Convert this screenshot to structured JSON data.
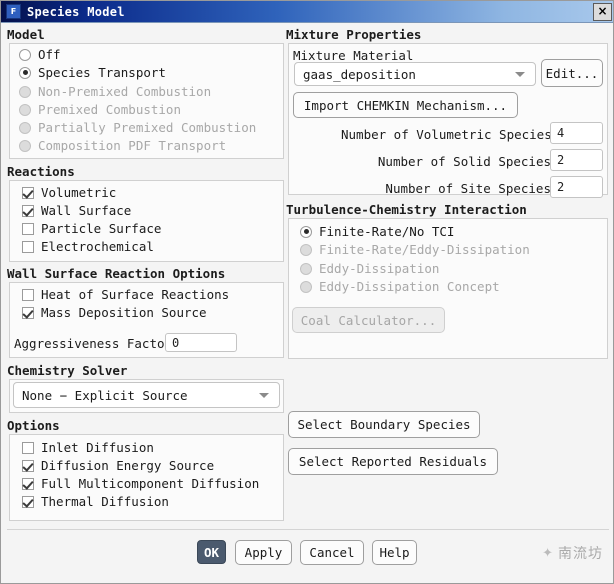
{
  "window": {
    "title": "Species Model",
    "icon": "fluent-app-icon",
    "close_label": "×"
  },
  "left": {
    "model": {
      "title": "Model",
      "options": [
        {
          "label": "Off",
          "selected": false,
          "disabled": false
        },
        {
          "label": "Species Transport",
          "selected": true,
          "disabled": false
        },
        {
          "label": "Non-Premixed Combustion",
          "selected": false,
          "disabled": true
        },
        {
          "label": "Premixed Combustion",
          "selected": false,
          "disabled": true
        },
        {
          "label": "Partially Premixed Combustion",
          "selected": false,
          "disabled": true
        },
        {
          "label": "Composition PDF Transport",
          "selected": false,
          "disabled": true
        }
      ]
    },
    "reactions": {
      "title": "Reactions",
      "options": [
        {
          "label": "Volumetric",
          "checked": true
        },
        {
          "label": "Wall Surface",
          "checked": true
        },
        {
          "label": "Particle Surface",
          "checked": false
        },
        {
          "label": "Electrochemical",
          "checked": false
        }
      ]
    },
    "wall_surface": {
      "title": "Wall Surface Reaction Options",
      "options": [
        {
          "label": "Heat of Surface Reactions",
          "checked": false
        },
        {
          "label": "Mass Deposition Source",
          "checked": true
        }
      ],
      "aggressiveness_label": "Aggressiveness Factor",
      "aggressiveness_value": "0"
    },
    "chemistry_solver": {
      "title": "Chemistry Solver",
      "selected": "None − Explicit Source"
    },
    "options": {
      "title": "Options",
      "items": [
        {
          "label": "Inlet Diffusion",
          "checked": false
        },
        {
          "label": "Diffusion Energy Source",
          "checked": true
        },
        {
          "label": "Full Multicomponent Diffusion",
          "checked": true
        },
        {
          "label": "Thermal Diffusion",
          "checked": true
        }
      ]
    }
  },
  "right": {
    "mixture_properties": {
      "title": "Mixture Properties",
      "mixture_material_label": "Mixture Material",
      "mixture_material_value": "gaas_deposition",
      "edit_button": "Edit...",
      "import_button": "Import CHEMKIN Mechanism...",
      "counts": [
        {
          "label": "Number of Volumetric Species",
          "value": "4"
        },
        {
          "label": "Number of Solid Species",
          "value": "2"
        },
        {
          "label": "Number of Site Species",
          "value": "2"
        }
      ]
    },
    "tci": {
      "title": "Turbulence-Chemistry Interaction",
      "options": [
        {
          "label": "Finite-Rate/No TCI",
          "selected": true,
          "disabled": false
        },
        {
          "label": "Finite-Rate/Eddy-Dissipation",
          "selected": false,
          "disabled": true
        },
        {
          "label": "Eddy-Dissipation",
          "selected": false,
          "disabled": true
        },
        {
          "label": "Eddy-Dissipation Concept",
          "selected": false,
          "disabled": true
        }
      ],
      "coal_calculator_button": "Coal Calculator..."
    },
    "actions": {
      "select_boundary_species": "Select Boundary Species",
      "select_reported_residuals": "Select Reported Residuals"
    }
  },
  "footer": {
    "ok": "OK",
    "apply": "Apply",
    "cancel": "Cancel",
    "help": "Help",
    "watermark": "南流坊"
  }
}
